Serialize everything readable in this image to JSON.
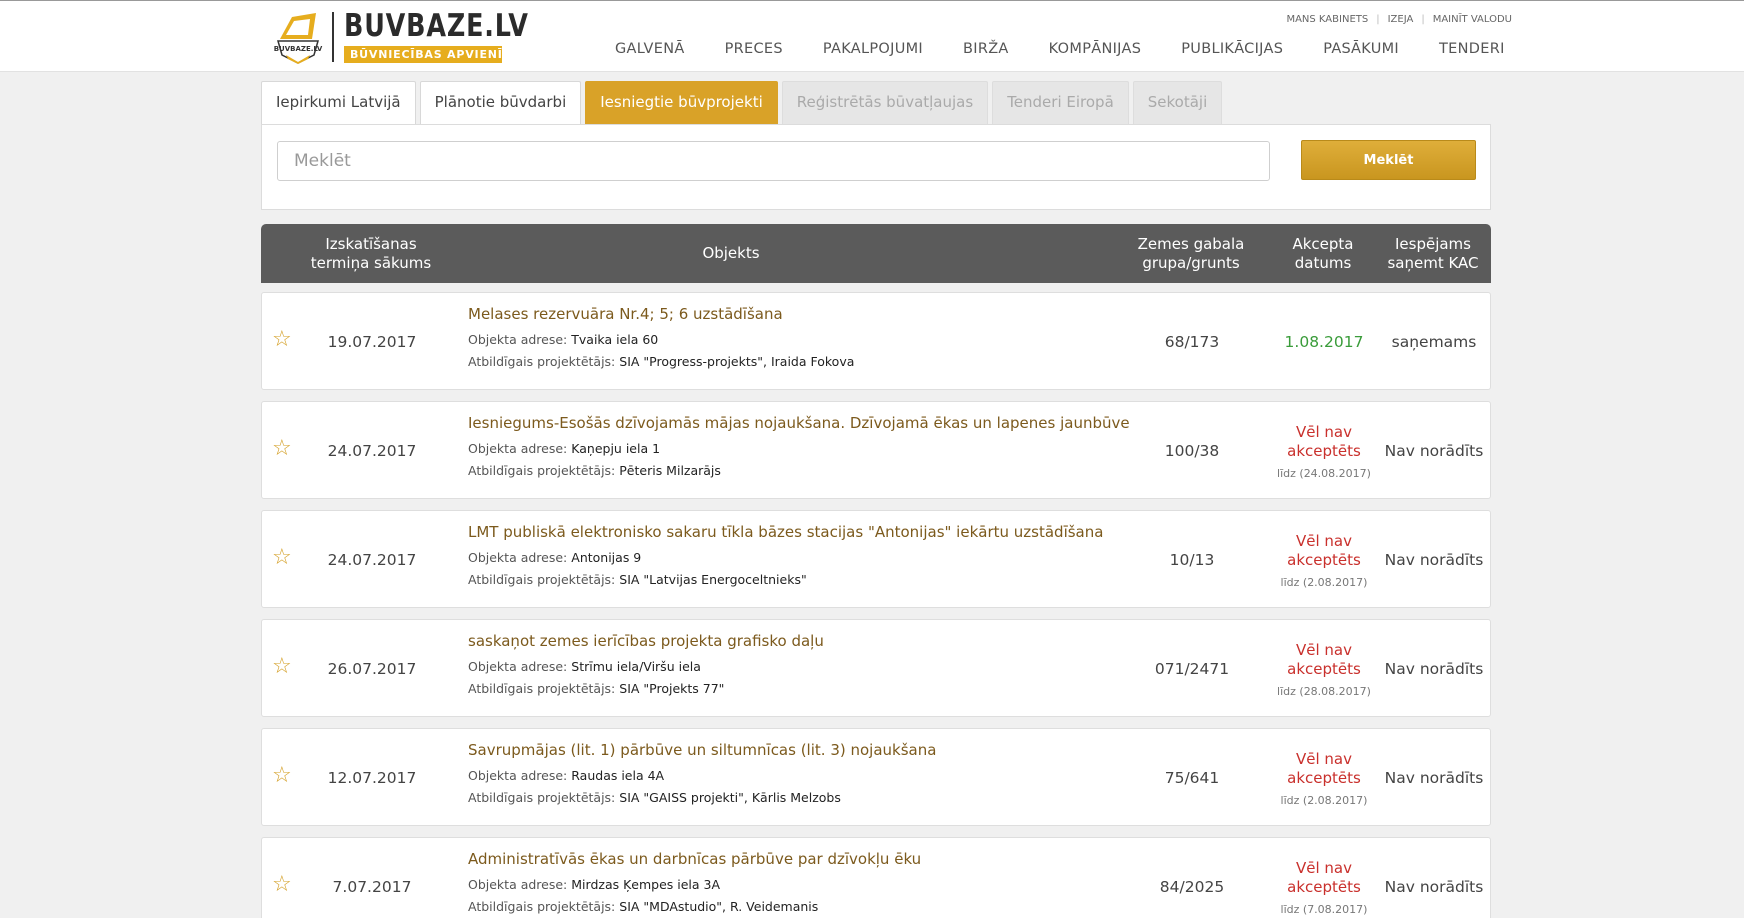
{
  "header": {
    "logo_name": "BUVBAZE.LV",
    "logo_tagline": "BŪVNIECĪBAS APVIENĪBA",
    "logo_badge_text": "BUVBAZE.LV",
    "top_links": [
      "MANS KABINETS",
      "IZEJA",
      "MAINĪT VALODU"
    ],
    "nav": [
      "GALVENĀ",
      "PRECES",
      "PAKALPOJUMI",
      "BIRŽA",
      "KOMPĀNIJAS",
      "PUBLIKĀCIJAS",
      "PASĀKUMI",
      "TENDERI"
    ]
  },
  "tabs": [
    {
      "label": "Iepirkumi Latvijā",
      "state": "normal"
    },
    {
      "label": "Plānotie būvdarbi",
      "state": "normal"
    },
    {
      "label": "Iesniegtie būvprojekti",
      "state": "active"
    },
    {
      "label": "Reģistrētās būvatļaujas",
      "state": "disabled"
    },
    {
      "label": "Tenderi Eiropā",
      "state": "disabled"
    },
    {
      "label": "Sekotāji",
      "state": "disabled"
    }
  ],
  "search": {
    "placeholder": "Meklēt",
    "button_label": "Meklēt"
  },
  "table": {
    "headers": {
      "date": "Izskatīšanas termiņa sākums",
      "object": "Objekts",
      "plot": "Zemes gabala grupa/grunts",
      "accept": "Akcepta datums",
      "kac": "Iespējams saņemt KAC"
    },
    "address_label": "Objekta adrese:",
    "designer_label": "Atbildīgais projektētājs:",
    "rows": [
      {
        "date": "19.07.2017",
        "title": "Melases rezervuāra Nr.4; 5; 6 uzstādīšana",
        "address": "Tvaika iela 60",
        "designer": "SIA \"Progress-projekts\", Iraida Fokova",
        "plot": "68/173",
        "accept_status": "accepted",
        "accept_date": "1.08.2017",
        "kac": "saņemams"
      },
      {
        "date": "24.07.2017",
        "title": "Iesniegums-Esošās dzīvojamās mājas nojaukšana. Dzīvojamā ēkas un lapenes jaunbūve",
        "address": "Kaņepju iela 1",
        "designer": "Pēteris Milzarājs",
        "plot": "100/38",
        "accept_status": "pending",
        "accept_text": "Vēl nav akceptēts",
        "accept_until": "līdz (24.08.2017)",
        "kac": "Nav norādīts"
      },
      {
        "date": "24.07.2017",
        "title": "LMT publiskā elektronisko sakaru tīkla bāzes stacijas \"Antonijas\" iekārtu uzstādīšana",
        "address": "Antonijas 9",
        "designer": "SIA \"Latvijas Energoceltnieks\"",
        "plot": "10/13",
        "accept_status": "pending",
        "accept_text": "Vēl nav akceptēts",
        "accept_until": "līdz (2.08.2017)",
        "kac": "Nav norādīts"
      },
      {
        "date": "26.07.2017",
        "title": "saskaņot zemes ierīcības projekta grafisko daļu",
        "address": "Strīmu iela/Viršu iela",
        "designer": "SIA \"Projekts 77\"",
        "plot": "071/2471",
        "accept_status": "pending",
        "accept_text": "Vēl nav akceptēts",
        "accept_until": "līdz (28.08.2017)",
        "kac": "Nav norādīts"
      },
      {
        "date": "12.07.2017",
        "title": "Savrupmājas (lit. 1) pārbūve un siltumnīcas (lit. 3) nojaukšana",
        "address": "Raudas iela 4A",
        "designer": "SIA \"GAISS projekti\", Kārlis Melzobs",
        "plot": "75/641",
        "accept_status": "pending",
        "accept_text": "Vēl nav akceptēts",
        "accept_until": "līdz (2.08.2017)",
        "kac": "Nav norādīts"
      },
      {
        "date": "7.07.2017",
        "title": "Administratīvās ēkas un darbnīcas pārbūve par dzīvokļu ēku",
        "address": "Mirdzas Ķempes iela 3A",
        "designer": "SIA \"MDAstudio\", R. Veidemanis",
        "plot": "84/2025",
        "accept_status": "pending",
        "accept_text": "Vēl nav akceptēts",
        "accept_until": "līdz (7.08.2017)",
        "kac": "Nav norādīts"
      }
    ]
  },
  "colors": {
    "accent": "#d9a228",
    "title_brown": "#7c5a1d",
    "accepted_green": "#3a9c3a",
    "pending_red": "#c9302c",
    "header_dark": "#5b5b5b"
  }
}
